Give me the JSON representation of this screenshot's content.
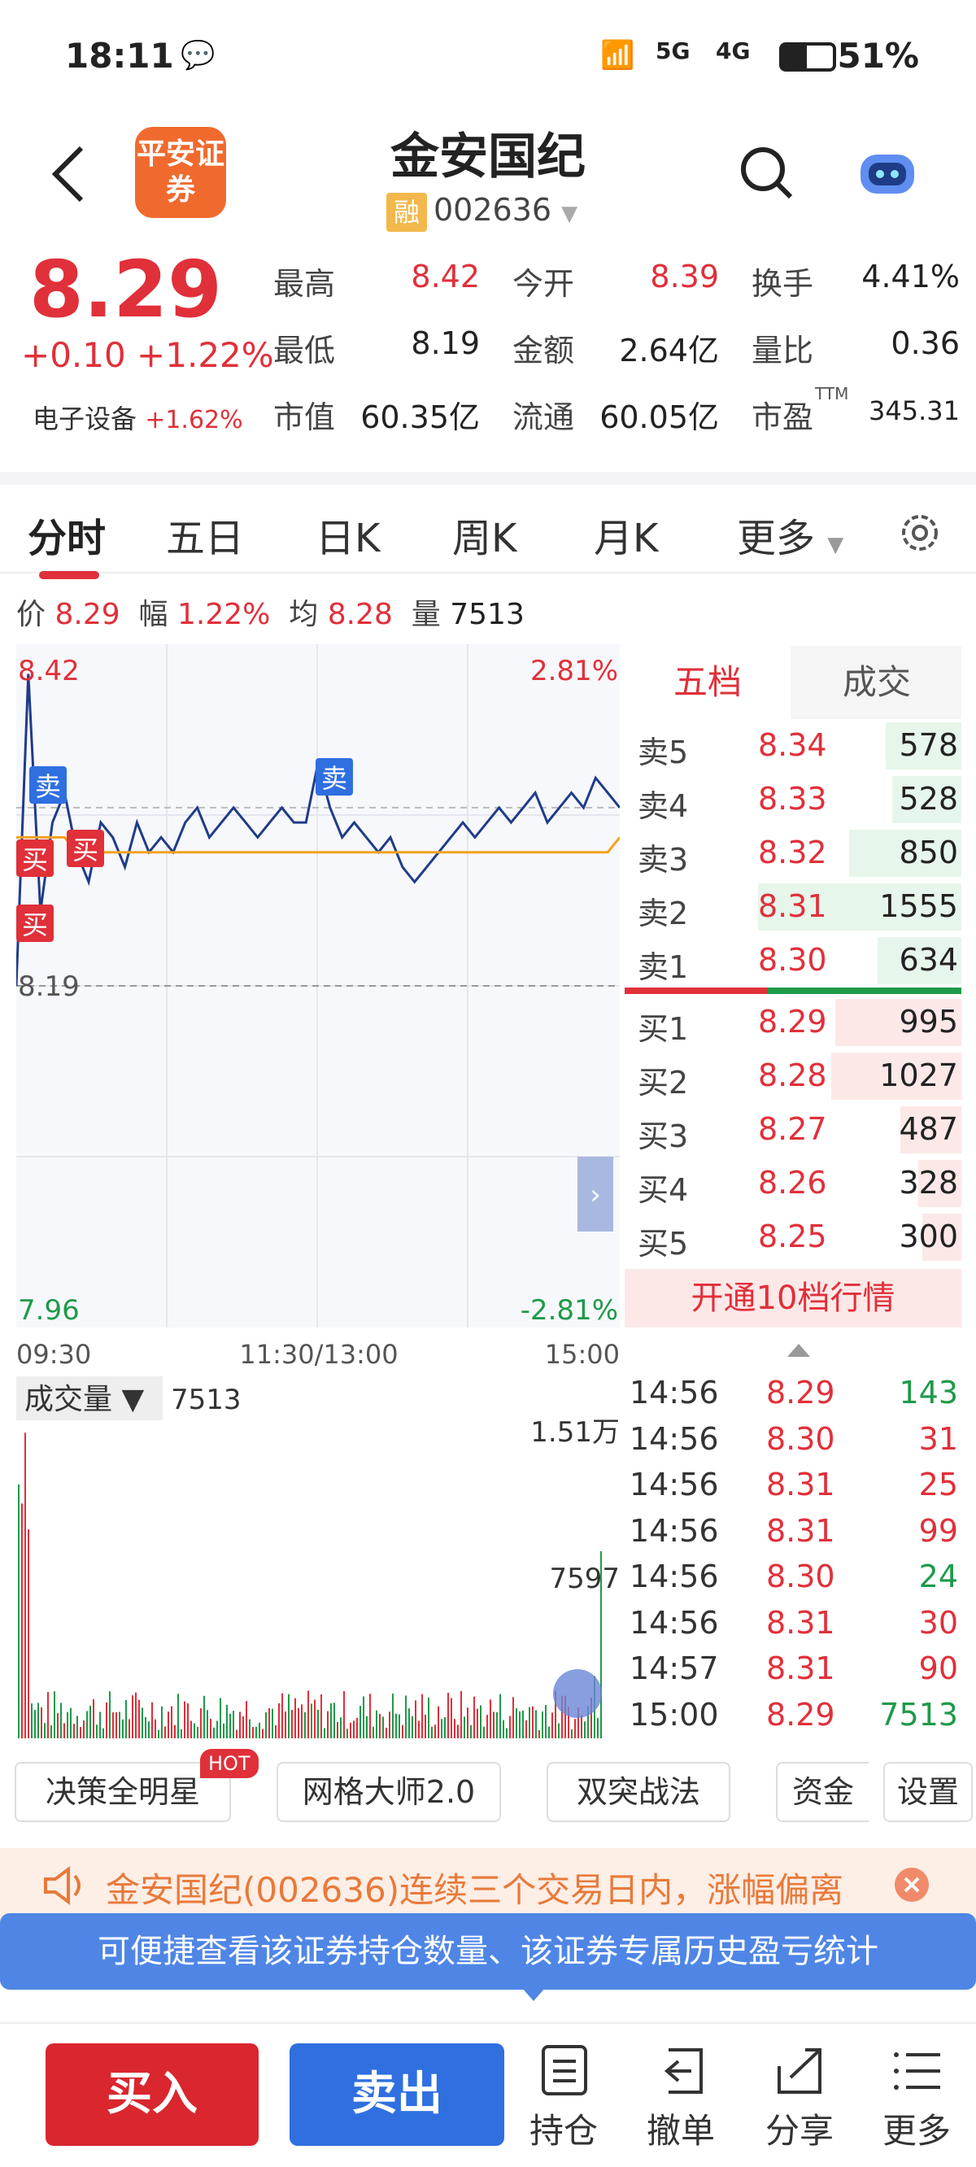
{
  "status": {
    "time": "18:11",
    "battery": "51%",
    "net1": "5G",
    "net2": "4G"
  },
  "header": {
    "logo_text": "平安证券",
    "title": "金安国纪",
    "rong": "融",
    "code": "002636"
  },
  "quote": {
    "price": "8.29",
    "change": "+0.10 +1.22%",
    "industry": "电子设备",
    "industry_chg": "+1.62%",
    "fields": [
      {
        "label": "最高",
        "value": "8.42",
        "color": "red"
      },
      {
        "label": "今开",
        "value": "8.39",
        "color": "red"
      },
      {
        "label": "换手",
        "value": "4.41%",
        "color": "black"
      },
      {
        "label": "最低",
        "value": "8.19",
        "color": "black"
      },
      {
        "label": "金额",
        "value": "2.64亿",
        "color": "black"
      },
      {
        "label": "量比",
        "value": "0.36",
        "color": "black"
      },
      {
        "label": "市值",
        "value": "60.35亿",
        "color": "black"
      },
      {
        "label": "流通",
        "value": "60.05亿",
        "color": "black"
      },
      {
        "label": "市盈",
        "value": "345.31",
        "color": "black"
      }
    ],
    "ttm": "TTM"
  },
  "tabs": [
    "分时",
    "五日",
    "日K",
    "周K",
    "月K",
    "更多"
  ],
  "info": {
    "price_label": "价",
    "price": "8.29",
    "amp_label": "幅",
    "amp": "1.22%",
    "avg_label": "均",
    "avg": "8.28",
    "vol_label": "量",
    "vol": "7513"
  },
  "chart_data": {
    "type": "line",
    "ylim": [
      7.96,
      8.42
    ],
    "y_labels": {
      "top": "8.42",
      "top_pct": "2.81%",
      "prev_close": "8.19",
      "bottom": "7.96",
      "bottom_pct": "-2.81%"
    },
    "x_ticks": [
      "09:30",
      "11:30/13:00",
      "15:00"
    ],
    "series": [
      {
        "values": [
          8.19,
          8.4,
          8.24,
          8.3,
          8.32,
          8.28,
          8.26,
          8.3,
          8.29,
          8.27,
          8.3,
          8.28,
          8.29,
          8.28,
          8.3,
          8.31,
          8.29,
          8.3,
          8.31,
          8.3,
          8.29,
          8.3,
          8.31,
          8.3,
          8.3,
          8.34,
          8.31,
          8.29,
          8.3,
          8.29,
          8.28,
          8.29,
          8.27,
          8.26,
          8.27,
          8.28,
          8.29,
          8.3,
          8.29,
          8.3,
          8.31,
          8.3,
          8.31,
          8.32,
          8.3,
          8.31,
          8.32,
          8.31,
          8.33,
          8.32,
          8.31
        ]
      },
      {
        "values": [
          8.29,
          8.29,
          8.29,
          8.29,
          8.29,
          8.28,
          8.28,
          8.28,
          8.28,
          8.28,
          8.28,
          8.28,
          8.28,
          8.28,
          8.28,
          8.28,
          8.28,
          8.28,
          8.28,
          8.28,
          8.28,
          8.28,
          8.28,
          8.28,
          8.28,
          8.28,
          8.28,
          8.28,
          8.28,
          8.28,
          8.28,
          8.28,
          8.28,
          8.28,
          8.28,
          8.28,
          8.28,
          8.28,
          8.28,
          8.28,
          8.28,
          8.28,
          8.28,
          8.28,
          8.28,
          8.28,
          8.28,
          8.28,
          8.28,
          8.28,
          8.29
        ]
      }
    ],
    "volume": {
      "label": "成交量",
      "value": "7513",
      "max_label": "1.51万",
      "mid_label": "7597"
    },
    "markers": [
      "卖",
      "卖",
      "买",
      "买",
      "买"
    ]
  },
  "book": {
    "tab_active": "五档",
    "tab_other": "成交",
    "asks": [
      {
        "label": "卖5",
        "price": "8.34",
        "vol": "578",
        "ratio": 0.37
      },
      {
        "label": "卖4",
        "price": "8.33",
        "vol": "528",
        "ratio": 0.34
      },
      {
        "label": "卖3",
        "price": "8.32",
        "vol": "850",
        "ratio": 0.55
      },
      {
        "label": "卖2",
        "price": "8.31",
        "vol": "1555",
        "ratio": 1.0
      },
      {
        "label": "卖1",
        "price": "8.30",
        "vol": "634",
        "ratio": 0.41
      }
    ],
    "bids": [
      {
        "label": "买1",
        "price": "8.29",
        "vol": "995",
        "ratio": 0.62
      },
      {
        "label": "买2",
        "price": "8.28",
        "vol": "1027",
        "ratio": 0.64
      },
      {
        "label": "买3",
        "price": "8.27",
        "vol": "487",
        "ratio": 0.3
      },
      {
        "label": "买4",
        "price": "8.26",
        "vol": "328",
        "ratio": 0.21
      },
      {
        "label": "买5",
        "price": "8.25",
        "vol": "300",
        "ratio": 0.19
      }
    ],
    "open10": "开通10档行情"
  },
  "ticks": [
    {
      "time": "14:56",
      "price": "8.29",
      "vol": "143",
      "pc": "red",
      "vc": "green"
    },
    {
      "time": "14:56",
      "price": "8.30",
      "vol": "31",
      "pc": "red",
      "vc": "red"
    },
    {
      "time": "14:56",
      "price": "8.31",
      "vol": "25",
      "pc": "red",
      "vc": "red"
    },
    {
      "time": "14:56",
      "price": "8.31",
      "vol": "99",
      "pc": "red",
      "vc": "red"
    },
    {
      "time": "14:56",
      "price": "8.30",
      "vol": "24",
      "pc": "red",
      "vc": "green"
    },
    {
      "time": "14:56",
      "price": "8.31",
      "vol": "30",
      "pc": "red",
      "vc": "red"
    },
    {
      "time": "14:57",
      "price": "8.31",
      "vol": "90",
      "pc": "red",
      "vc": "red"
    },
    {
      "time": "15:00",
      "price": "8.29",
      "vol": "7513",
      "pc": "red",
      "vc": "green"
    }
  ],
  "tools": {
    "t1": "决策全明星",
    "hot": "HOT",
    "t2": "网格大师2.0",
    "t3": "双突战法",
    "t4": "资金",
    "t5": "设置"
  },
  "notice": "金安国纪(002636)连续三个交易日内，涨幅偏离",
  "tip": "可便捷查看该证券持仓数量、该证券专属历史盈亏统计",
  "bottom": {
    "buy": "买入",
    "sell": "卖出",
    "hold": "持仓",
    "cancel": "撤单",
    "share": "分享",
    "more": "更多"
  },
  "colors": {
    "red": "#e0303a",
    "green": "#1f9a4a",
    "blue": "#2f6fe0",
    "price_line": "#1f3c88",
    "avg_line": "#f2a21c"
  }
}
